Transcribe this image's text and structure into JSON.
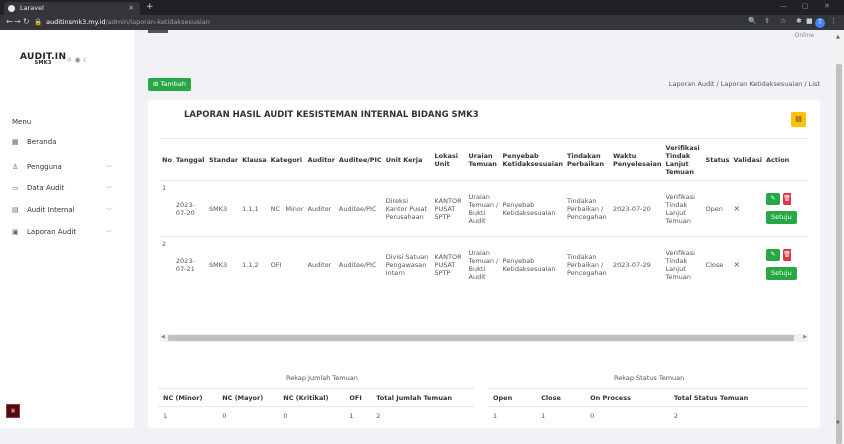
{
  "browser": {
    "tab_title": "Laravel",
    "url_host": "auditinsmk3.my.id",
    "url_path": "/admin/laporan-ketidaksesuaian",
    "profile_initial": "T"
  },
  "sidebar": {
    "logo": "AUDIT.IN",
    "logo_sub": "SMK3",
    "menu_title": "Menu",
    "items": [
      {
        "label": "Beranda",
        "icon": "grid-icon"
      },
      {
        "label": "Pengguna",
        "icon": "user-icon"
      },
      {
        "label": "Data Audit",
        "icon": "file-icon"
      },
      {
        "label": "Audit Internal",
        "icon": "document-icon"
      },
      {
        "label": "Laporan Audit",
        "icon": "report-icon"
      }
    ]
  },
  "header": {
    "online": "Online"
  },
  "toolbar": {
    "add_label": "Tambah"
  },
  "breadcrumb": {
    "text": "Laporan Audit / Laporan Ketidaksesuaian / List"
  },
  "report": {
    "title": "LAPORAN HASIL AUDIT KESISTEMAN INTERNAL BIDANG SMK3",
    "columns": [
      "No",
      "Tanggal",
      "Standar",
      "Klausa",
      "Kategori",
      "",
      "Auditor",
      "Auditee/PIC",
      "Unit Kerja",
      "Lokasi Unit",
      "Uraian Temuan",
      "Penyebab Ketidaksesuaian",
      "Tindakan Perbaikan",
      "Waktu Penyelesaian",
      "Verifikasi Tindak Lanjut Temuan",
      "Status",
      "Validasi",
      "Action"
    ],
    "rows": [
      {
        "no": "1",
        "tanggal": "2023-07-20",
        "standar": "SMK3",
        "klausa": "1.1.1",
        "kategori": "NC",
        "kategori2": "Minor",
        "auditor": "Auditor",
        "auditee": "Auditee/PIC",
        "unit": "Direksi Kantor Pusat Perusahaan",
        "lokasi": "KANTOR PUSAT SPTP",
        "uraian": "Uraian Temuan / Bukti Audit",
        "penyebab": "Penyebab Ketidaksesuaian",
        "tindakan": "Tindakan Perbaikan / Pencegahan",
        "waktu": "2023-07-20",
        "verifikasi": "Verifikasi Tindak Lanjut Temuan",
        "status": "Open",
        "validasi": "×"
      },
      {
        "no": "2",
        "tanggal": "2023-07-21",
        "standar": "SMK3",
        "klausa": "1.1.2",
        "kategori": "OFI",
        "kategori2": "",
        "auditor": "Auditor",
        "auditee": "Auditee/PIC",
        "unit": "Divisi Satuan Pengawasan Intern",
        "lokasi": "KANTOR PUSAT SPTP",
        "uraian": "Uraian Temuan / Bukti Audit",
        "penyebab": "Penyebab Ketidaksesuaian",
        "tindakan": "Tindakan Perbaikan / Pencegahan",
        "waktu": "2023-07-29",
        "verifikasi": "Verifikasi Tindak Lanjut Temuan",
        "status": "Close",
        "validasi": "×"
      }
    ],
    "setuju_label": "Setuju"
  },
  "rekap_jumlah": {
    "title": "Rekap Jumlah Temuan",
    "headers": [
      "NC (Minor)",
      "NC (Mayor)",
      "NC (Kritikal)",
      "OFI",
      "Total Jumlah Temuan"
    ],
    "values": [
      "1",
      "0",
      "0",
      "1",
      "2"
    ]
  },
  "rekap_status": {
    "title": "Rekap Status Temuan",
    "headers": [
      "Open",
      "Close",
      "On Process",
      "Total Status Temuan"
    ],
    "values": [
      "1",
      "1",
      "0",
      "2"
    ]
  }
}
